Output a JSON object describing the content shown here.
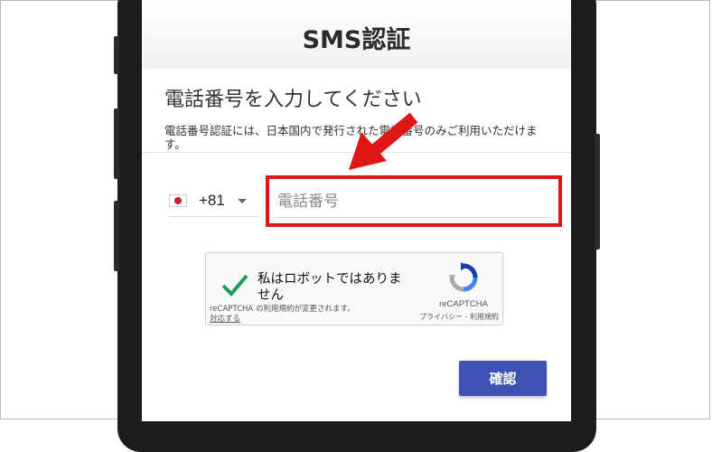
{
  "header": {
    "title": "SMS認証"
  },
  "form": {
    "heading": "電話番号を入力してください",
    "description": "電話番号認証には、日本国内で発行された電話番号のみご利用いただけます。",
    "country": {
      "flag": "jp-flag-icon",
      "code": "+81"
    },
    "phone_input": {
      "placeholder": "電話番号",
      "value": ""
    },
    "confirm_label": "確認"
  },
  "recaptcha": {
    "checkbox_label": "私はロボットではありません",
    "checked": true,
    "notice": "reCAPTCHA の利用規約が変更されます。",
    "action_link": "対応する",
    "brand": "reCAPTCHA",
    "terms": "プライバシー - 利用規約"
  },
  "annotation": {
    "color": "#e01515",
    "arrow_icon": "red-arrow-icon"
  },
  "colors": {
    "primary": "#3f51b5",
    "check": "#1e9e5b",
    "highlight": "#e01515"
  }
}
